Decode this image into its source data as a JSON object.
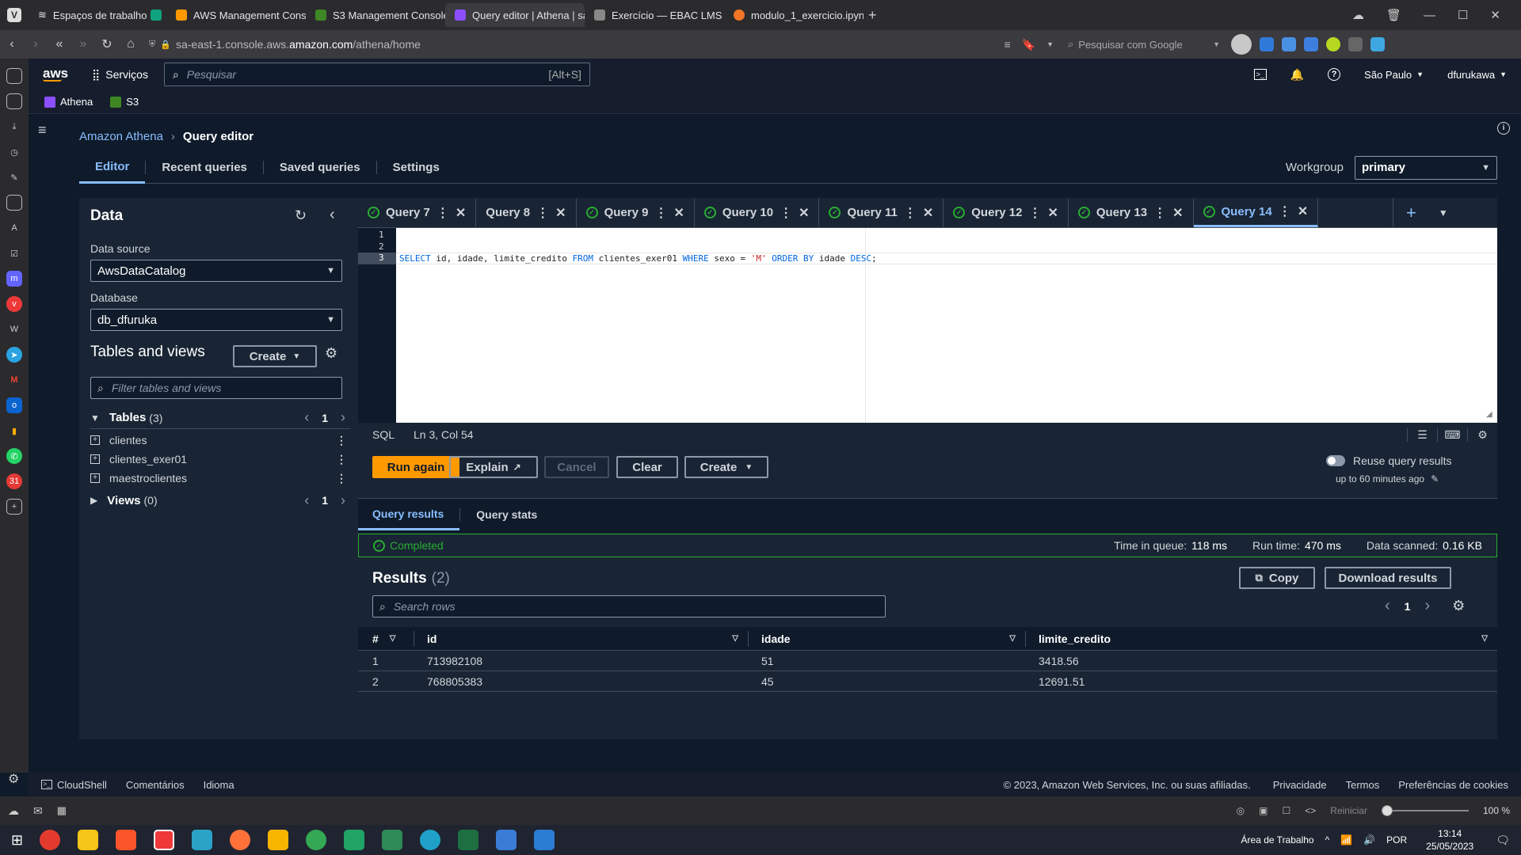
{
  "browser": {
    "workspaces_label": "Espaços de trabalho",
    "tabs": [
      {
        "label": "AWS Management Console",
        "color": "#ff9900"
      },
      {
        "label": "S3 Management Console",
        "color": "#3f8624"
      },
      {
        "label": "Query editor | Athena | sa-e",
        "color": "#8c4fff",
        "active": true
      },
      {
        "label": "Exercício — EBAC LMS",
        "color": "#888888"
      },
      {
        "label": "modulo_1_exercicio.ipynb -",
        "color": "#f37626"
      }
    ],
    "url_host": "sa-east-1.console.aws.",
    "url_domain": "amazon.com",
    "url_path": "/athena/home",
    "search_placeholder": "Pesquisar com Google"
  },
  "aws_header": {
    "logo": "aws",
    "services_label": "Serviços",
    "search_placeholder": "Pesquisar",
    "search_shortcut": "[Alt+S]",
    "region": "São Paulo",
    "user": "dfurukawa",
    "favorites": [
      "Athena",
      "S3"
    ]
  },
  "breadcrumb": {
    "root": "Amazon Athena",
    "current": "Query editor"
  },
  "page_tabs": [
    "Editor",
    "Recent queries",
    "Saved queries",
    "Settings"
  ],
  "workgroup": {
    "label": "Workgroup",
    "value": "primary"
  },
  "data_panel": {
    "title": "Data",
    "data_source_label": "Data source",
    "data_source_value": "AwsDataCatalog",
    "database_label": "Database",
    "database_value": "db_dfuruka",
    "tables_views_title": "Tables and views",
    "create_label": "Create",
    "filter_placeholder": "Filter tables and views",
    "tables_label": "Tables",
    "tables_count": "(3)",
    "tables_page": "1",
    "tables": [
      "clientes",
      "clientes_exer01",
      "maestroclientes"
    ],
    "views_label": "Views",
    "views_count": "(0)",
    "views_page": "1"
  },
  "query_tabs": [
    "Query 7",
    "Query 8",
    "Query 9",
    "Query 10",
    "Query 11",
    "Query 12",
    "Query 13",
    "Query 14"
  ],
  "editor": {
    "line_numbers": [
      "1",
      "2",
      "3"
    ],
    "sql_parts": {
      "kw_select": "SELECT",
      "cols": " id, idade, limite_credito ",
      "kw_from": "FROM",
      "table": " clientes_exer01 ",
      "kw_where": "WHERE",
      "cond": " sexo = ",
      "str": "'M'",
      "kw_order": " ORDER BY",
      "ord_col": " idade ",
      "kw_desc": "DESC",
      "end": ";"
    },
    "language": "SQL",
    "cursor_pos": "Ln 3, Col 54"
  },
  "actions": {
    "run_again": "Run again",
    "explain": "Explain",
    "cancel": "Cancel",
    "clear": "Clear",
    "create": "Create",
    "reuse_label": "Reuse query results",
    "reuse_sub": "up to 60 minutes ago"
  },
  "results_tabs": [
    "Query results",
    "Query stats"
  ],
  "status": {
    "state": "Completed",
    "queue_label": "Time in queue:",
    "queue_value": "118 ms",
    "run_label": "Run time:",
    "run_value": "470 ms",
    "scanned_label": "Data scanned:",
    "scanned_value": "0.16 KB"
  },
  "results": {
    "title": "Results",
    "count": "(2)",
    "copy_label": "Copy",
    "download_label": "Download results",
    "search_placeholder": "Search rows",
    "page": "1",
    "columns": [
      "#",
      "id",
      "idade",
      "limite_credito"
    ],
    "rows": [
      [
        "1",
        "713982108",
        "51",
        "3418.56"
      ],
      [
        "2",
        "768805383",
        "45",
        "12691.51"
      ]
    ]
  },
  "footer": {
    "cloudshell": "CloudShell",
    "feedback": "Comentários",
    "language": "Idioma",
    "copyright": "© 2023, Amazon Web Services, Inc. ou suas afiliadas.",
    "privacy": "Privacidade",
    "terms": "Termos",
    "cookies": "Preferências de cookies"
  },
  "browser_status": {
    "reset": "Reiniciar",
    "zoom": "100 %"
  },
  "taskbar": {
    "desktop_label": "Área de Trabalho",
    "lang": "POR",
    "time": "13:14",
    "date": "25/05/2023"
  }
}
